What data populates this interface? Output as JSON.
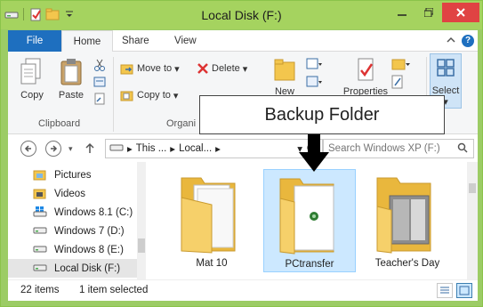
{
  "window": {
    "title": "Local Disk (F:)"
  },
  "ribbon": {
    "tabs": {
      "file": "File",
      "home": "Home",
      "share": "Share",
      "view": "View"
    },
    "clipboard": {
      "copy": "Copy",
      "paste": "Paste",
      "group": "Clipboard"
    },
    "organize": {
      "move_to": "Move to",
      "copy_to": "Copy to",
      "delete": "Delete",
      "group": "Organi"
    },
    "new": {
      "label": "New"
    },
    "open": {
      "properties": "Properties"
    },
    "select": {
      "label": "Select"
    }
  },
  "callout": {
    "text": "Backup Folder"
  },
  "address": {
    "crumbs": [
      "This ...",
      "Local...",
      ""
    ],
    "search_placeholder": "Search Windows XP (F:)"
  },
  "nav_pane": {
    "items": [
      {
        "label": "Pictures",
        "icon": "pictures-folder-icon"
      },
      {
        "label": "Videos",
        "icon": "videos-folder-icon"
      },
      {
        "label": "Windows 8.1 (C:)",
        "icon": "windows-drive-icon"
      },
      {
        "label": "Windows 7 (D:)",
        "icon": "drive-icon"
      },
      {
        "label": "Windows 8 (E:)",
        "icon": "drive-icon"
      },
      {
        "label": "Local Disk (F:)",
        "icon": "drive-icon",
        "selected": true
      }
    ]
  },
  "content": {
    "items": [
      {
        "label": "Mat 10",
        "selected": false
      },
      {
        "label": "PCtransfer",
        "selected": true
      },
      {
        "label": "Teacher's Day",
        "selected": false
      }
    ]
  },
  "status": {
    "item_count": "22 items",
    "selection": "1 item selected"
  },
  "colors": {
    "accent_green": "#9ccc65",
    "file_tab": "#1e6fbf",
    "close_button": "#e04343",
    "selection": "#cce8ff"
  }
}
